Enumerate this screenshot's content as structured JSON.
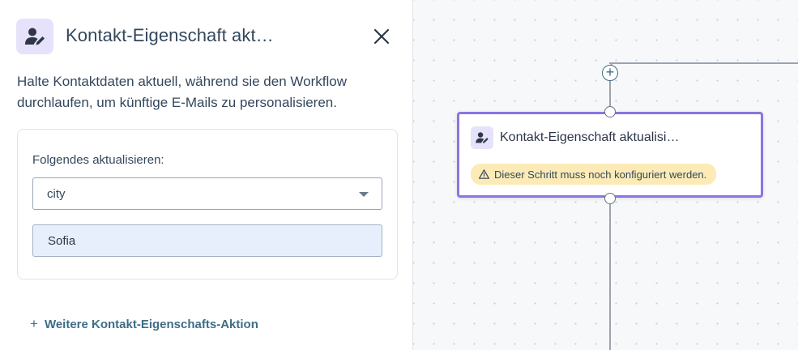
{
  "panel": {
    "title": "Kontakt-Eigenschaft akt…",
    "description": "Halte Kontaktdaten aktuell, während sie den Workflow durchlaufen, um künftige E-Mails zu personalisieren.",
    "update_label": "Folgendes aktualisieren:",
    "property_select_value": "city",
    "value_input": "Sofia",
    "add_action_label": "Weitere Kontakt-Eigenschafts-Aktion",
    "add_action_icon": "+",
    "icon": "contact-edit-icon"
  },
  "canvas": {
    "add_node_icon": "+",
    "node": {
      "title": "Kontakt-Eigenschaft aktualisi…",
      "warning": "Dieser Schritt muss noch konfiguriert werden.",
      "icon": "contact-edit-icon"
    }
  },
  "colors": {
    "accent_purple": "#8b74e3",
    "icon_bg": "#e6e2fb",
    "link_teal": "#3f6d86",
    "warning_bg": "#fcebb6",
    "input_bg": "#e8effc"
  }
}
